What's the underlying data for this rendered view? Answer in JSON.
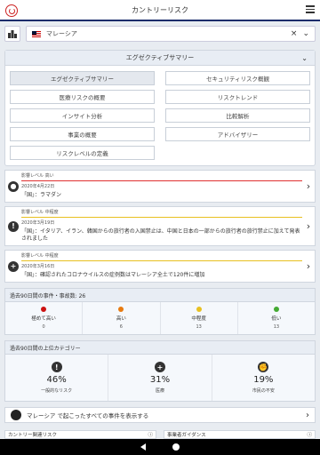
{
  "header": {
    "title": "カントリーリスク"
  },
  "search": {
    "value": "マレーシア",
    "clear_symbol": "×",
    "chevron": "⌄"
  },
  "summary": {
    "title": "エグゼクティブサマリー",
    "buttons": [
      "エグゼクティブサマリー",
      "セキュリティリスク概観",
      "医療リスクの概要",
      "リスクトレンド",
      "インサイト分析",
      "比較解析",
      "事業の概要",
      "アドバイザリー",
      "リスクレベルの定義"
    ]
  },
  "events": [
    {
      "level": "影響レベル 高い",
      "date": "2020年4月22日",
      "desc": "「国」：ラマダン",
      "level_color": "#e03030",
      "icon": "bird-icon"
    },
    {
      "level": "影響レベル 中程度",
      "date": "2020年3月19日",
      "desc": "「国」：イタリア、イラン、韓国からの旅行者の入国禁止は、中国と日本の一部からの旅行者の旅行禁止に加えて発表されました",
      "level_color": "#e8c020",
      "icon": "alert-icon"
    },
    {
      "level": "影響レベル 中程度",
      "date": "2020年3月16日",
      "desc": "「国」：確認されたコロナウイルスの症例数はマレーシア全土で120件に増加",
      "level_color": "#e8c020",
      "icon": "medical-icon"
    }
  ],
  "stats": {
    "title": "過去90日間の事件・事故数: 26",
    "cells": [
      {
        "label": "極めて高い",
        "count": "0",
        "color": "#cc1111"
      },
      {
        "label": "高い",
        "count": "6",
        "color": "#e87a10"
      },
      {
        "label": "中程度",
        "count": "13",
        "color": "#e8c020"
      },
      {
        "label": "低い",
        "count": "13",
        "color": "#44aa33"
      }
    ]
  },
  "categories": {
    "title": "過去90日間の上位カテゴリー",
    "cells": [
      {
        "pct": "46%",
        "label": "一般的なリスク",
        "icon": "alert-icon"
      },
      {
        "pct": "31%",
        "label": "医療",
        "icon": "medical-icon"
      },
      {
        "pct": "19%",
        "label": "市民の不安",
        "icon": "unrest-icon"
      }
    ]
  },
  "all_events": {
    "label": "マレーシア で起こったすべての事件を表示する"
  },
  "bottom_cards": [
    "カントリー関連リスク",
    "事業者ガイダンス"
  ]
}
